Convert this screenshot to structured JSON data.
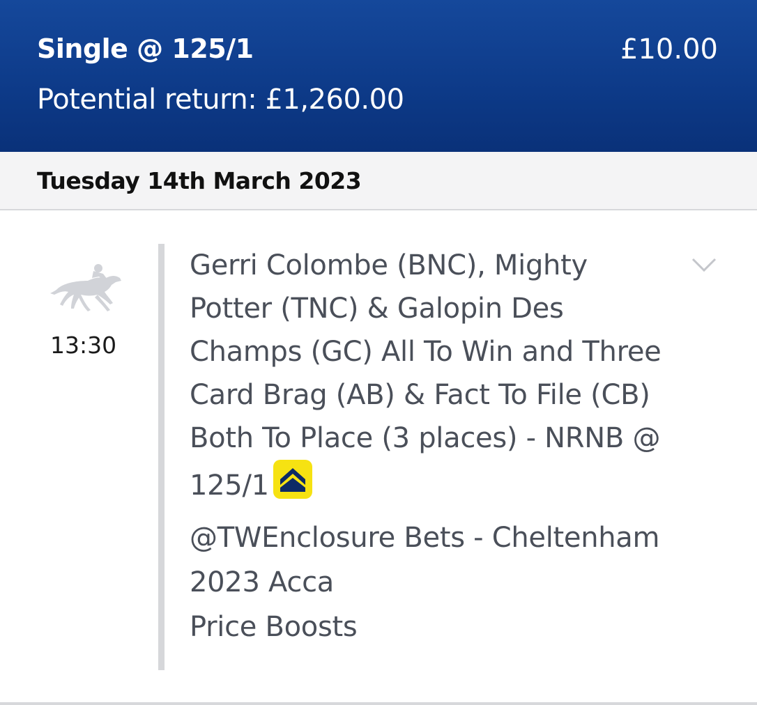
{
  "header": {
    "bet_type": "Single @ 125/1",
    "stake": "£10.00",
    "potential_return": "Potential return: £1,260.00"
  },
  "date_bar": {
    "date": "Tuesday 14th March 2023"
  },
  "event": {
    "time": "13:30",
    "sport_icon": "horse-racing-icon",
    "selection_text": "Gerri Colombe (BNC), Mighty Potter (TNC) & Galopin Des Champs (GC) All To Win and Three Card Brag (AB) & Fact To File (CB) Both To Place (3 places) - NRNB @ 125/1",
    "boost_icon": "price-boost-icon",
    "promo_lines": [
      "@TWEnclosure Bets - Cheltenham",
      "2023 Acca",
      "Price Boosts"
    ],
    "expand_icon": "chevron-down-icon"
  },
  "colors": {
    "header_bg": "#0d3a88",
    "date_bar_bg": "#f4f4f5",
    "boost_yellow": "#f6e212",
    "boost_navy": "#0d2a66",
    "text_grey": "#4a4f59"
  }
}
